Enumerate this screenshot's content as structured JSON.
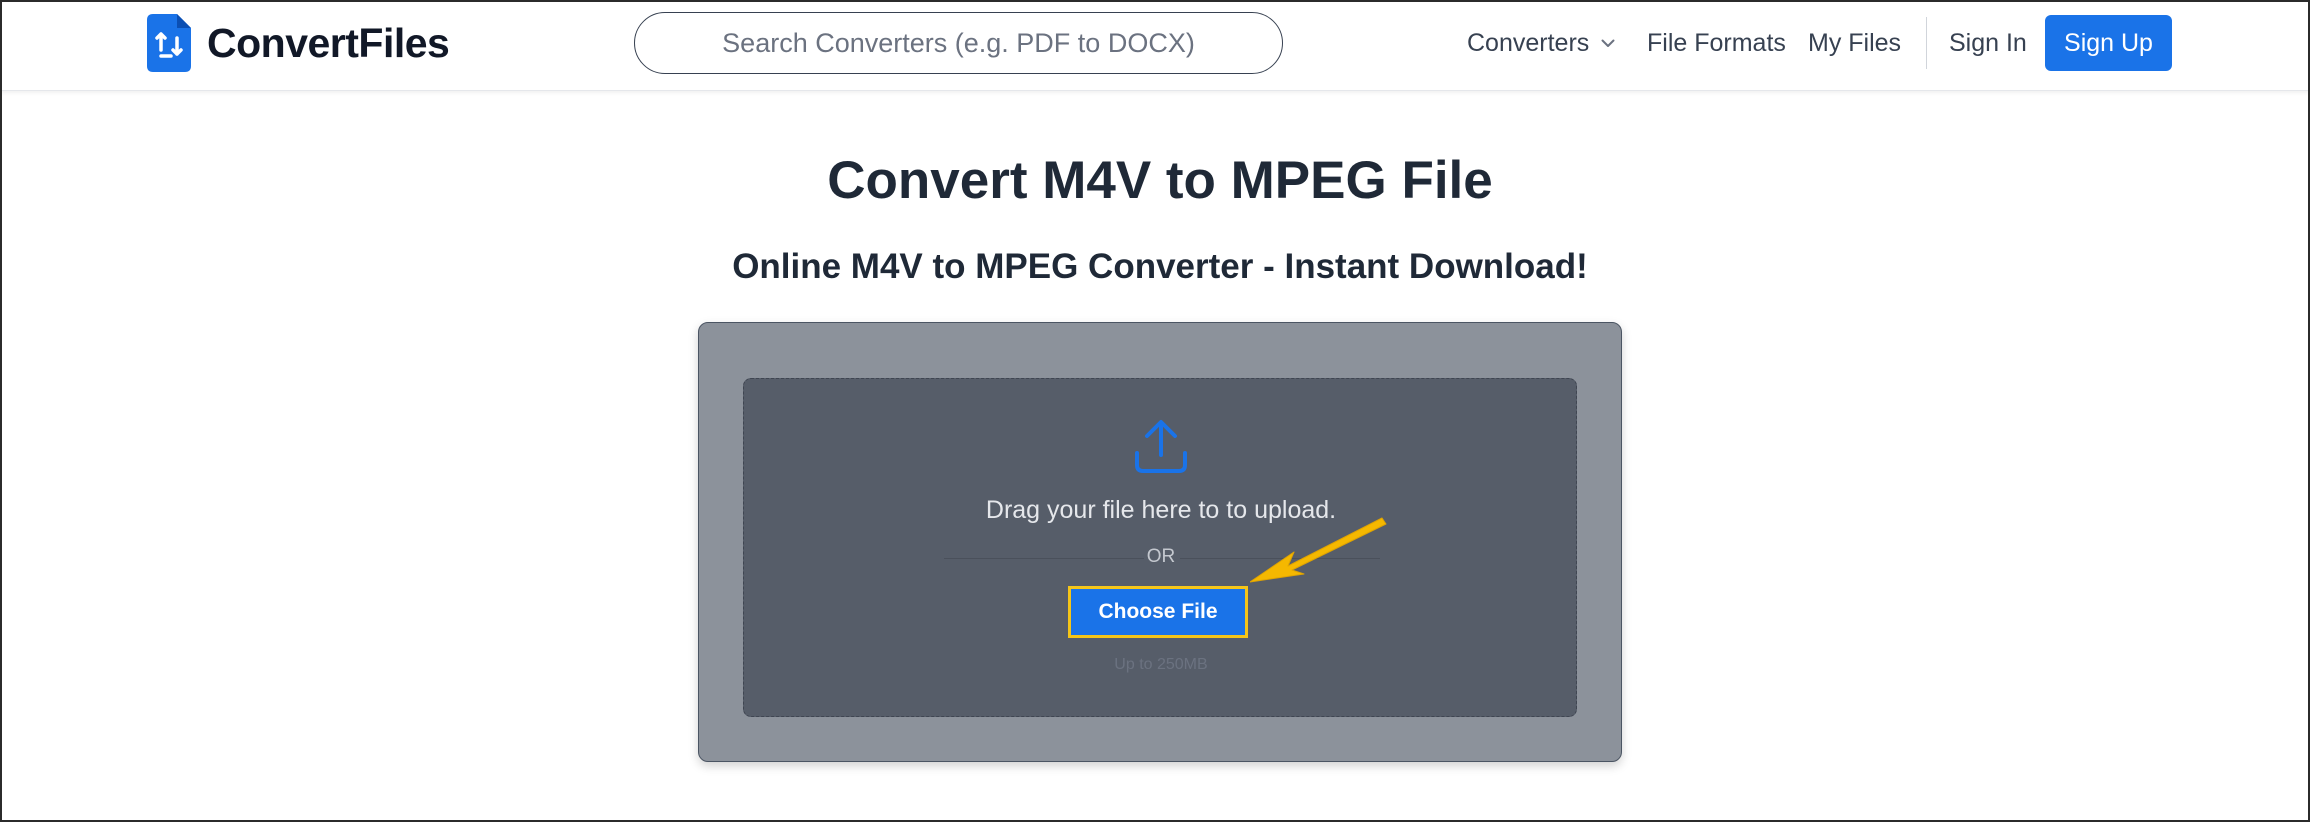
{
  "header": {
    "logo_text": "ConvertFiles",
    "search_placeholder": "Search Converters (e.g. PDF to DOCX)",
    "nav": {
      "converters": "Converters",
      "file_formats": "File Formats",
      "my_files": "My Files",
      "sign_in": "Sign In",
      "sign_up": "Sign Up"
    }
  },
  "main": {
    "title": "Convert M4V to MPEG File",
    "subtitle": "Online M4V to MPEG Converter - Instant Download!",
    "upload": {
      "drag_text": "Drag your file here to to upload.",
      "or_text": "OR",
      "choose_button": "Choose File",
      "limit_text": "Up to 250MB"
    }
  },
  "icons": {
    "logo": "convert-file-logo-icon",
    "converters_chevron": "chevron-down-icon",
    "upload": "upload-icon",
    "annotation": "annotation-arrow-icon"
  },
  "colors": {
    "brand_blue": "#1a73e8",
    "annotation_yellow": "#f5c518",
    "upload_outer": "#8c929b",
    "upload_inner": "#565d69"
  }
}
